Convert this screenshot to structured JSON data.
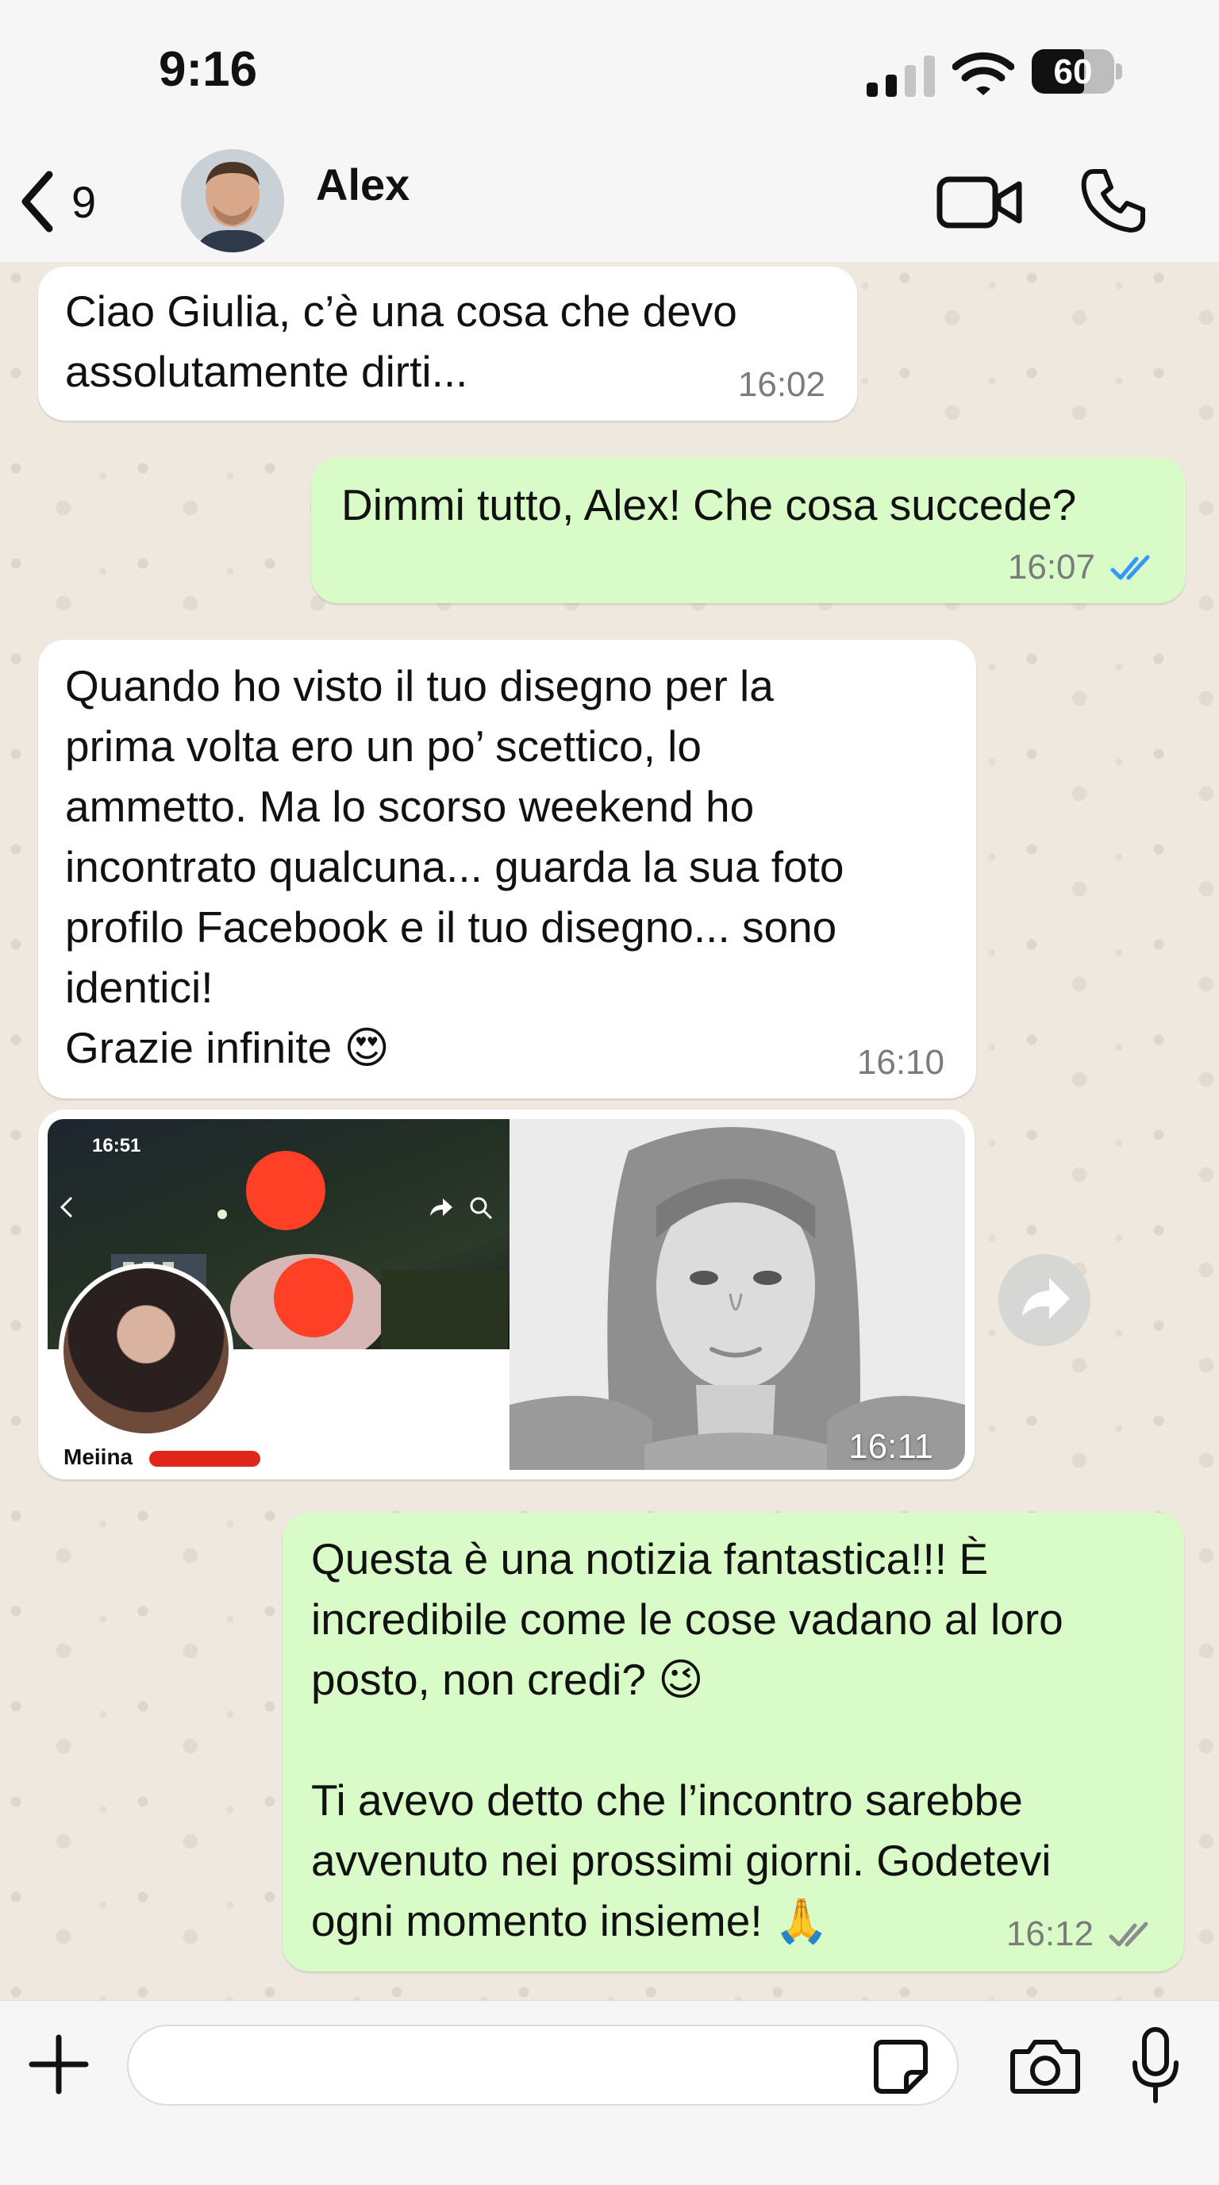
{
  "status_bar": {
    "time": "9:16",
    "battery": "60",
    "signal_bars": 2,
    "battery_level": 0.6
  },
  "header": {
    "back_count": "9",
    "contact_name": "Alex"
  },
  "messages": [
    {
      "direction": "in",
      "text": "Ciao Giulia, c’è una cosa che devo\nassolutamente dirti...",
      "time": "16:02"
    },
    {
      "direction": "out",
      "text": "Dimmi tutto, Alex! Che cosa succede?",
      "time": "16:07",
      "read": true
    },
    {
      "direction": "in",
      "text": "Quando ho visto il tuo disegno per la\nprima volta ero un po’ scettico, lo\nammetto. Ma lo scorso weekend ho\nincontrato qualcuna... guarda la sua foto\nprofilo Facebook e il tuo disegno... sono\nidentici!\nGrazie infinite 😍",
      "time": "16:10"
    },
    {
      "direction": "in",
      "type": "images",
      "time": "16:11",
      "screenshot_time": "16:51",
      "profile_name": "Meiina"
    },
    {
      "direction": "out",
      "text": "Questa è una notizia fantastica!!! È\nincredibile come le cose vadano al loro\nposto, non credi? 😉\n\nTi avevo detto che l’incontro sarebbe\navvenuto nei prossimi giorni. Godetevi\nogni momento insieme! 🙏",
      "time": "16:12",
      "read": false
    }
  ],
  "input": {
    "placeholder": ""
  },
  "colors": {
    "incoming": "#ffffff",
    "outgoing": "#d8fbc8",
    "read_tick": "#3497f9",
    "unread_tick": "#8c8c8c"
  },
  "icons": [
    "back-chevron-icon",
    "video-camera-icon",
    "phone-icon",
    "forward-icon",
    "plus-icon",
    "sticker-icon",
    "camera-icon",
    "microphone-icon"
  ]
}
